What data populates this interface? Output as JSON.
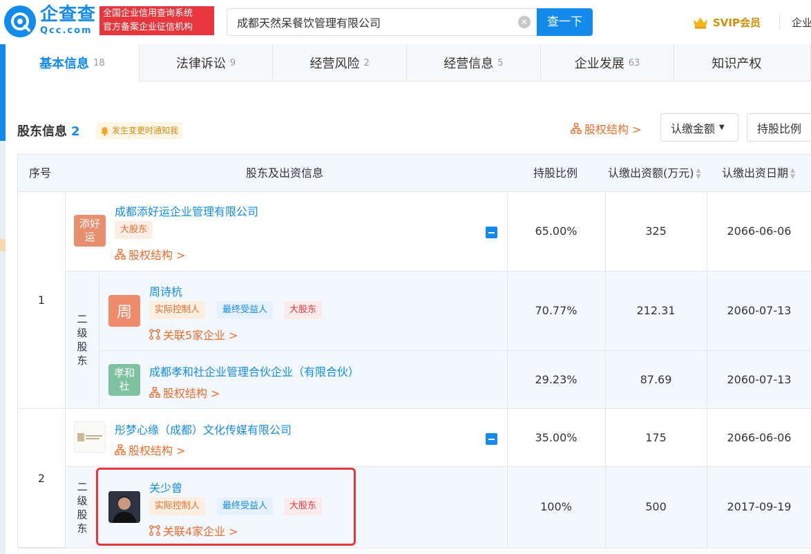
{
  "header": {
    "logo_name": "企查查",
    "logo_domain": "Qcc.com",
    "slogan_line1": "全国企业信用查询系统",
    "slogan_line2": "官方备案企业征信机构",
    "search_value": "成都天然呆餐饮管理有限公司",
    "search_button": "查一下",
    "svip_label": "SVIP会员",
    "link_partial": "企业"
  },
  "tabs": [
    {
      "label": "基本信息",
      "count": "18",
      "active": true
    },
    {
      "label": "法律诉讼",
      "count": "9"
    },
    {
      "label": "经营风险",
      "count": "2"
    },
    {
      "label": "经营信息",
      "count": "5"
    },
    {
      "label": "企业发展",
      "count": "63"
    },
    {
      "label": "知识产权",
      "count": ""
    }
  ],
  "section": {
    "title": "股东信息",
    "count": "2",
    "notify": "发生变更时通知我",
    "equity_link": "股权结构 >",
    "dropdown1": "认缴金额",
    "dropdown2": "持股比例"
  },
  "table": {
    "headers": {
      "seq": "序号",
      "info": "股东及出资信息",
      "ratio": "持股比例",
      "amount": "认缴出资额(万元)",
      "date": "认缴出资日期"
    },
    "second_level_label": "二级股东",
    "rows": [
      {
        "seq": "1",
        "name": "成都添好运企业管理有限公司",
        "avatar_text": "添好运",
        "tag": "大股东",
        "link": "股权结构 >",
        "ratio": "65.00%",
        "amount": "325",
        "date": "2066-06-06",
        "subs": [
          {
            "name": "周诗杭",
            "avatar_text": "周",
            "tags": [
              "实际控制人",
              "最终受益人",
              "大股东"
            ],
            "link": "关联5家企业 >",
            "ratio": "70.77%",
            "amount": "212.31",
            "date": "2060-07-13"
          },
          {
            "name": "成都孝和社企业管理合伙企业（有限合伙）",
            "avatar_text": "孝和社",
            "link": "股权结构 >",
            "ratio": "29.23%",
            "amount": "87.69",
            "date": "2060-07-13"
          }
        ]
      },
      {
        "seq": "2",
        "name": "彤梦心缘（成都）文化传媒有限公司",
        "link": "股权结构 >",
        "ratio": "35.00%",
        "amount": "175",
        "date": "2066-06-06",
        "subs": [
          {
            "name": "关少曾",
            "tags": [
              "实际控制人",
              "最终受益人",
              "大股东"
            ],
            "link": "关联4家企业 >",
            "ratio": "100%",
            "amount": "500",
            "date": "2017-09-19"
          }
        ]
      }
    ]
  },
  "colors": {
    "brand_blue": "#128bed",
    "link_orange": "#ee6c2a",
    "highlight_red": "#e8373c",
    "svip_gold": "#d08d05"
  }
}
